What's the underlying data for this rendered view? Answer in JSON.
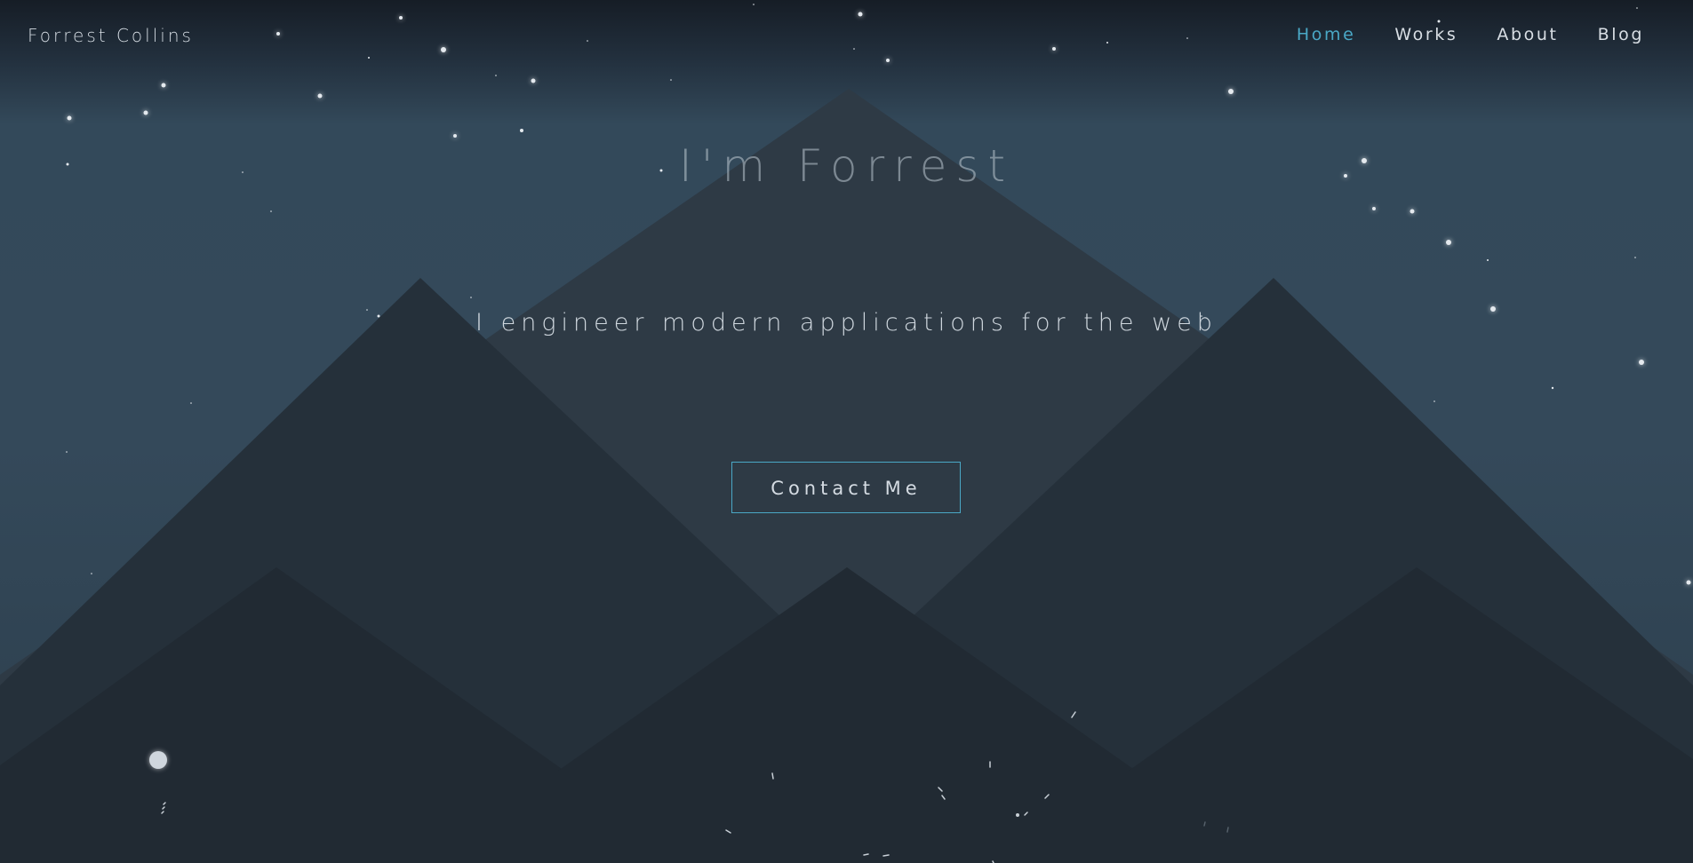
{
  "header": {
    "brand": "Forrest Collins",
    "nav": [
      {
        "label": "Home",
        "active": true
      },
      {
        "label": "Works",
        "active": false
      },
      {
        "label": "About",
        "active": false
      },
      {
        "label": "Blog",
        "active": false
      }
    ]
  },
  "hero": {
    "title": "I'm Forrest",
    "subtitle": "I engineer modern applications for the web",
    "cta_label": "Contact Me"
  },
  "colors": {
    "accent": "#4aa8c6",
    "sky": "#34495a",
    "mountain_back": "#2e3a45",
    "mountain_mid": "#25303a",
    "mountain_front": "#212a33"
  }
}
